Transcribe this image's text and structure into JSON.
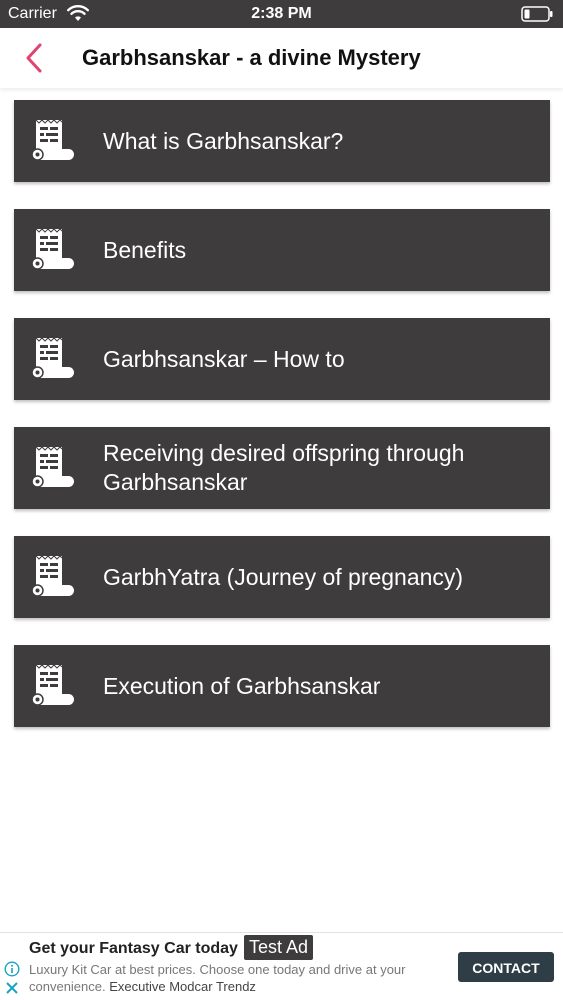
{
  "status_bar": {
    "carrier": "Carrier",
    "time": "2:38 PM",
    "wifi_icon": "wifi-icon",
    "battery_icon": "battery-icon"
  },
  "nav": {
    "title": "Garbhsanskar - a divine Mystery",
    "back_icon": "chevron-left-icon",
    "back_color": "#e0436e"
  },
  "menu": {
    "item_background": "#3e3c3c",
    "item_icon": "scroll-icon",
    "items": [
      {
        "label": "What is Garbhsanskar?"
      },
      {
        "label": "Benefits"
      },
      {
        "label": "Garbhsanskar – How to"
      },
      {
        "label": "Receiving desired offspring through Garbhsanskar"
      },
      {
        "label": "GarbhYatra (Journey of pregnancy)"
      },
      {
        "label": "Execution of Garbhsanskar"
      }
    ]
  },
  "ad": {
    "headline": "Get your Fantasy Car today",
    "badge": "Test Ad",
    "body": "Luxury Kit Car at best prices. Choose one today and drive at your convenience.",
    "brand": "Executive Modcar Trendz",
    "cta": "CONTACT US",
    "cta_color": "#2f3d47",
    "info_icon": "info-icon",
    "close_icon": "close-icon",
    "accent": "#1aa3c4"
  }
}
